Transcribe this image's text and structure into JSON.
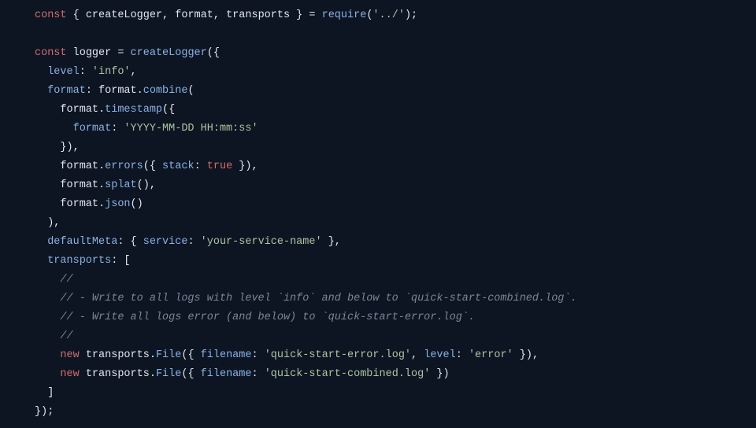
{
  "kw_const1": "const",
  "destr_open": " { ",
  "id_createLogger": "createLogger",
  "comma_sp": ", ",
  "id_format": "format",
  "id_transports": "transports",
  "destr_close": " } ",
  "eq": "= ",
  "fn_require": "require",
  "p_open": "(",
  "str_reqpath": "'../'",
  "p_close": ")",
  "semi": ";",
  "kw_const2": "const",
  "sp": " ",
  "id_logger": "logger",
  "eq2": " = ",
  "fn_createLogger": "createLogger",
  "call_open": "({",
  "indent1": "  ",
  "indent2": "    ",
  "indent3": "      ",
  "key_level": "level",
  "colon_sp": ": ",
  "str_info": "'info'",
  "comma": ",",
  "key_format": "format",
  "id_format2": "format",
  "dot": ".",
  "fn_combine": "combine",
  "fn_timestamp": "timestamp",
  "obj_open": "({",
  "key_tsformat": "format",
  "str_tsfmt": "'YYYY-MM-DD HH:mm:ss'",
  "obj_close_comma": "}),",
  "fn_errors": "errors",
  "obj_open2": "({ ",
  "key_stack": "stack",
  "kw_true": "true",
  "obj_close2": " }),",
  "fn_splat": "splat",
  "empty_call_comma": "(),",
  "fn_json": "json",
  "empty_call": "()",
  "close_paren_comma": "),",
  "key_defaultMeta": "defaultMeta",
  "obj_open3": "{ ",
  "key_service": "service",
  "str_servicename": "'your-service-name'",
  "obj_close3": " },",
  "key_transports": "transports",
  "arr_open": "[",
  "cm1": "//",
  "cm2": "// - Write to all logs with level `info` and below to `quick-start-combined.log`.",
  "cm3": "// - Write all logs error (and below) to `quick-start-error.log`.",
  "cm4": "//",
  "kw_new": "new",
  "id_transports2": "transports",
  "fn_File": "File",
  "file_open": "({ ",
  "key_filename": "filename",
  "str_errlog": "'quick-start-error.log'",
  "key_level2": "level",
  "str_error": "'error'",
  "file_close_comma": " }),",
  "str_comblog": "'quick-start-combined.log'",
  "file_close": " })",
  "arr_close": "]",
  "final_close": "});"
}
